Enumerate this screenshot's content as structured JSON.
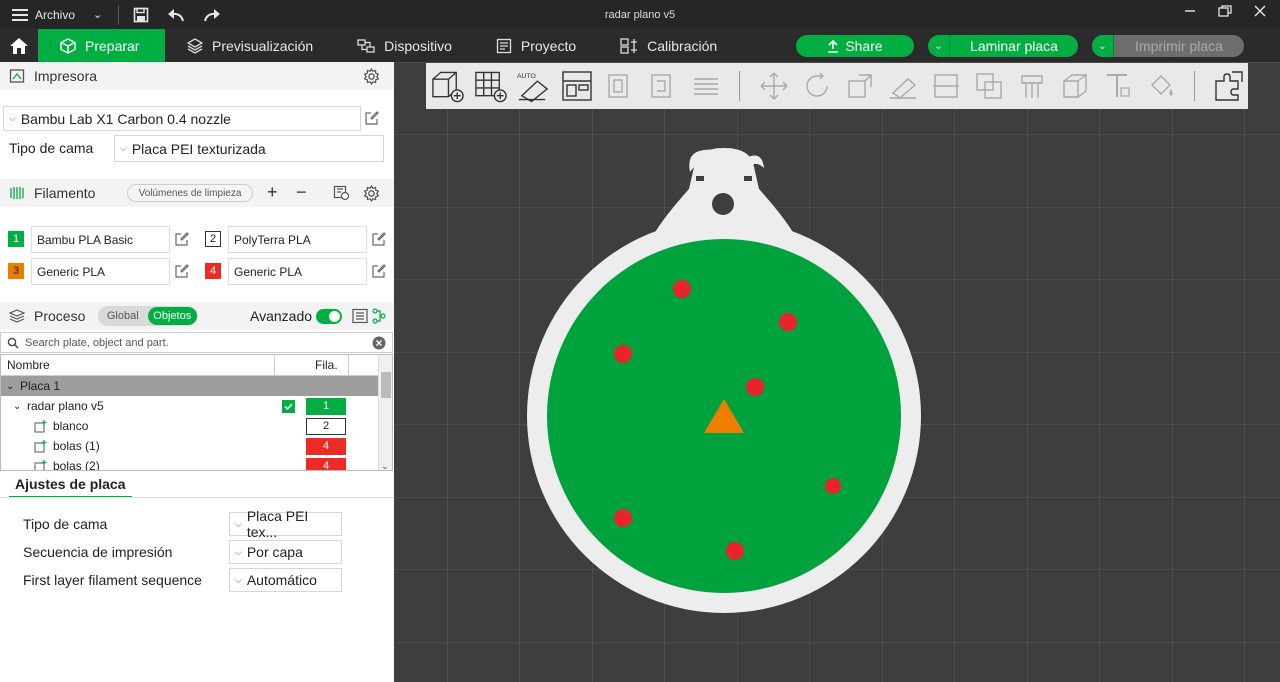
{
  "titlebar": {
    "menu_label": "Archivo",
    "title": "radar plano v5"
  },
  "nav": {
    "tabs": [
      {
        "label": "Preparar"
      },
      {
        "label": "Previsualización"
      },
      {
        "label": "Dispositivo"
      },
      {
        "label": "Proyecto"
      },
      {
        "label": "Calibración"
      }
    ],
    "share_label": "Share",
    "slice_label": "Laminar placa",
    "print_label": "Imprimir placa"
  },
  "printer": {
    "header": "Impresora",
    "preset": "Bambu Lab X1 Carbon 0.4 nozzle",
    "bed_label": "Tipo de cama",
    "bed_value": "Placa PEI texturizada"
  },
  "filament": {
    "header": "Filamento",
    "purge_button": "Volúmenes de limpieza",
    "plus": "+",
    "minus": "−",
    "slots": [
      {
        "num": "1",
        "name": "Bambu PLA Basic",
        "color": "#00ae42",
        "text_color": "#ffffff"
      },
      {
        "num": "2",
        "name": "PolyTerra PLA",
        "color": "#ffffff",
        "text_color": "#222222"
      },
      {
        "num": "3",
        "name": "Generic PLA",
        "color": "#ef7d00",
        "text_color": "#222222"
      },
      {
        "num": "4",
        "name": "Generic PLA",
        "color": "#ee2a24",
        "text_color": "#ffffff"
      }
    ]
  },
  "process": {
    "header": "Proceso",
    "toggle_global": "Global",
    "toggle_objects": "Objetos",
    "advanced_label": "Avanzado",
    "search_placeholder": "Search plate, object and part."
  },
  "tree": {
    "col_name": "Nombre",
    "col_fil": "Fila.",
    "rows": [
      {
        "label": "Placa 1"
      },
      {
        "label": "radar plano v5",
        "fil": "1"
      },
      {
        "label": "blanco",
        "fil": "2"
      },
      {
        "label": "bolas (1)",
        "fil": "4"
      },
      {
        "label": "bolas (2)",
        "fil": "4"
      }
    ]
  },
  "plate_settings": {
    "tab_label": "Ajustes de placa",
    "rows": [
      {
        "label": "Tipo de cama",
        "value": "Placa PEI tex..."
      },
      {
        "label": "Secuencia de impresión",
        "value": "Por capa"
      },
      {
        "label": "First layer filament sequence",
        "value": "Automático"
      }
    ]
  },
  "colors": {
    "accent": "#00ae42",
    "model_green": "#00a23e",
    "model_white": "#ededed",
    "dot_red": "#e8242a",
    "arrow_orange": "#ef7d00",
    "grid_line": "#5a5a5a"
  }
}
